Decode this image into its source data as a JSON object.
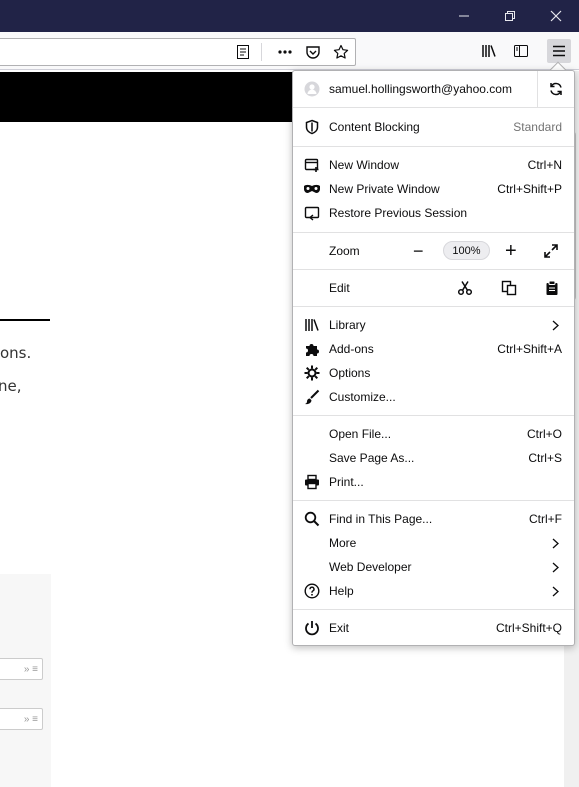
{
  "window": {
    "minimize_icon": "minimize-icon",
    "restore_icon": "restore-icon",
    "close_icon": "close-icon",
    "titlebar_color": "#212347"
  },
  "page": {
    "text_line_1": "ons.",
    "text_line_2": "ne,",
    "mini_bar_1": "» ≡",
    "mini_bar_2": "» ≡"
  },
  "menu": {
    "account": "samuel.hollingsworth@yahoo.com",
    "content_blocking": {
      "label": "Content Blocking",
      "status": "Standard"
    },
    "new_window": {
      "label": "New Window",
      "shortcut": "Ctrl+N"
    },
    "new_private_window": {
      "label": "New Private Window",
      "shortcut": "Ctrl+Shift+P"
    },
    "restore_session": {
      "label": "Restore Previous Session"
    },
    "zoom": {
      "label": "Zoom",
      "minus": "−",
      "value": "100%",
      "plus": "+"
    },
    "edit": {
      "label": "Edit"
    },
    "library": {
      "label": "Library"
    },
    "addons": {
      "label": "Add-ons",
      "shortcut": "Ctrl+Shift+A"
    },
    "options": {
      "label": "Options"
    },
    "customize": {
      "label": "Customize..."
    },
    "open_file": {
      "label": "Open File...",
      "shortcut": "Ctrl+O"
    },
    "save_page": {
      "label": "Save Page As...",
      "shortcut": "Ctrl+S"
    },
    "print": {
      "label": "Print..."
    },
    "find": {
      "label": "Find in This Page...",
      "shortcut": "Ctrl+F"
    },
    "more": {
      "label": "More"
    },
    "web_developer": {
      "label": "Web Developer"
    },
    "help": {
      "label": "Help"
    },
    "exit": {
      "label": "Exit",
      "shortcut": "Ctrl+Shift+Q"
    }
  }
}
